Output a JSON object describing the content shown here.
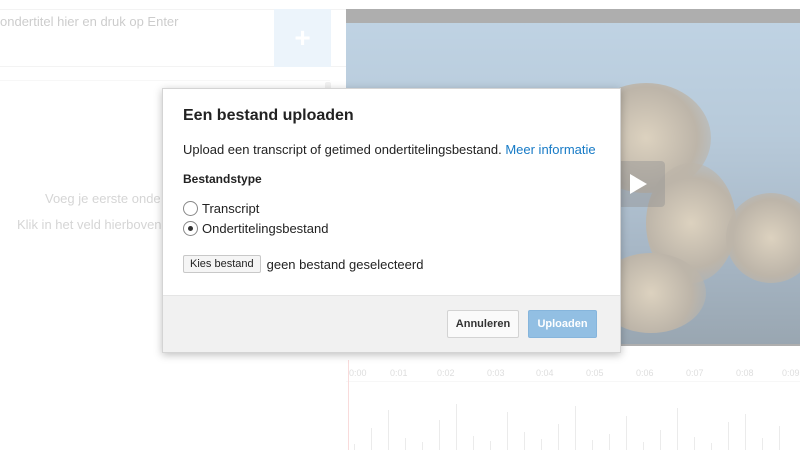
{
  "editor": {
    "caption_placeholder": "ondertitel hier en druk op Enter",
    "add_button_icon": "plus-icon",
    "empty_title": "Voeg je eerste onde",
    "empty_hint": "Klik in het veld hierboven"
  },
  "video": {
    "play_icon": "play-icon"
  },
  "timeline": {
    "ticks": [
      "0:00",
      "0:01",
      "0:02",
      "0:03",
      "0:04",
      "0:05",
      "0:06",
      "0:07",
      "0:08",
      "0:09"
    ]
  },
  "dialog": {
    "title": "Een bestand uploaden",
    "description": "Upload een transcript of getimed ondertitelingsbestand.",
    "more_info_link": "Meer informatie",
    "file_type_label": "Bestandstype",
    "options": [
      {
        "label": "Transcript",
        "checked": false
      },
      {
        "label": "Ondertitelingsbestand",
        "checked": true
      }
    ],
    "choose_file_button": "Kies bestand",
    "no_file_text": "geen bestand geselecteerd",
    "cancel_button": "Annuleren",
    "upload_button": "Uploaden"
  },
  "colors": {
    "link": "#167ac6",
    "upload_button": "#92bfe3",
    "add_button": "#d8e8f6"
  }
}
